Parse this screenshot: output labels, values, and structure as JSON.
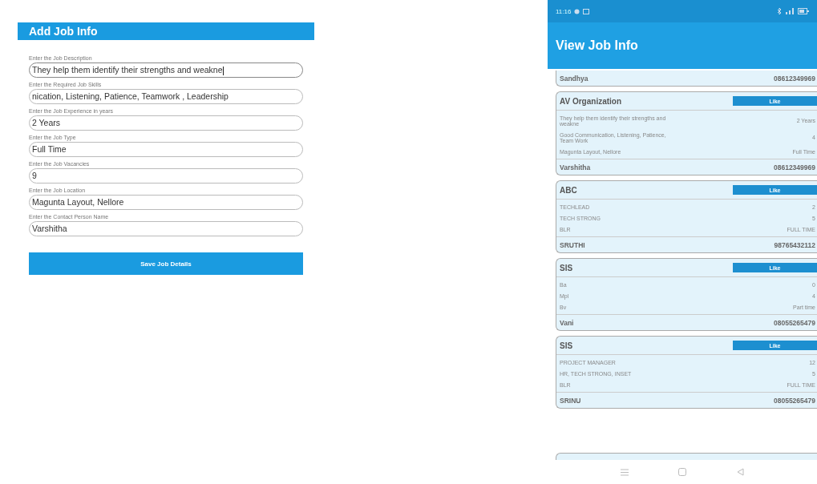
{
  "add_screen": {
    "title": "Add Job Info",
    "fields": [
      {
        "label": "Enter the Job Description",
        "value": "They help them identify their strengths and weakne",
        "focused": true
      },
      {
        "label": "Enter the Required Job Skills",
        "value": "nication, Listening, Patience, Teamwork , Leadership",
        "focused": false
      },
      {
        "label": "Enter the Job Experience in years",
        "value": "2 Years",
        "focused": false
      },
      {
        "label": "Enter the Job Type",
        "value": "Full Time",
        "focused": false
      },
      {
        "label": "Enter the Job Vacancies",
        "value": "9",
        "focused": false
      },
      {
        "label": "Enter the Job Location",
        "value": "Magunta Layout, Nellore",
        "focused": false
      },
      {
        "label": "Enter the Contact Person Name",
        "value": "Varshitha",
        "focused": false
      }
    ],
    "save_button": "Save Job Details"
  },
  "view_screen": {
    "status_bar": {
      "time": "11:16"
    },
    "title": "View Job Info",
    "jobs": [
      {
        "partial": true,
        "contact": "Sandhya",
        "phone": "08612349969"
      },
      {
        "partial": false,
        "company": "AV Organization",
        "like_button": "Like",
        "rows": [
          [
            "They help them identify their strengths and weakne",
            "2 Years"
          ],
          [
            "Good Communication, Listening, Patience, Team Work",
            "4"
          ],
          [
            "Magunta Layout, Nellore",
            "Full Time"
          ]
        ],
        "contact": "Varshitha",
        "phone": "08612349969"
      },
      {
        "partial": false,
        "company": "ABC",
        "like_button": "Like",
        "rows": [
          [
            "TECHLEAD",
            "2"
          ],
          [
            "TECH STRONG",
            "5"
          ],
          [
            "BLR",
            "FULL TIME"
          ]
        ],
        "contact": "SRUTHI",
        "phone": "98765432112"
      },
      {
        "partial": false,
        "company": "SIS",
        "like_button": "Like",
        "rows": [
          [
            "Ba",
            "0"
          ],
          [
            "Mpl",
            "4"
          ],
          [
            "Bv",
            "Part time"
          ]
        ],
        "contact": "Vani",
        "phone": "08055265479"
      },
      {
        "partial": false,
        "company": "SIS",
        "like_button": "Like",
        "rows": [
          [
            "PROJECT MANAGER",
            "12"
          ],
          [
            "HR, TECH STRONG, INSET",
            "5"
          ],
          [
            "BLR",
            "FULL TIME"
          ]
        ],
        "contact": "SRINU",
        "phone": "08055265479"
      }
    ]
  }
}
